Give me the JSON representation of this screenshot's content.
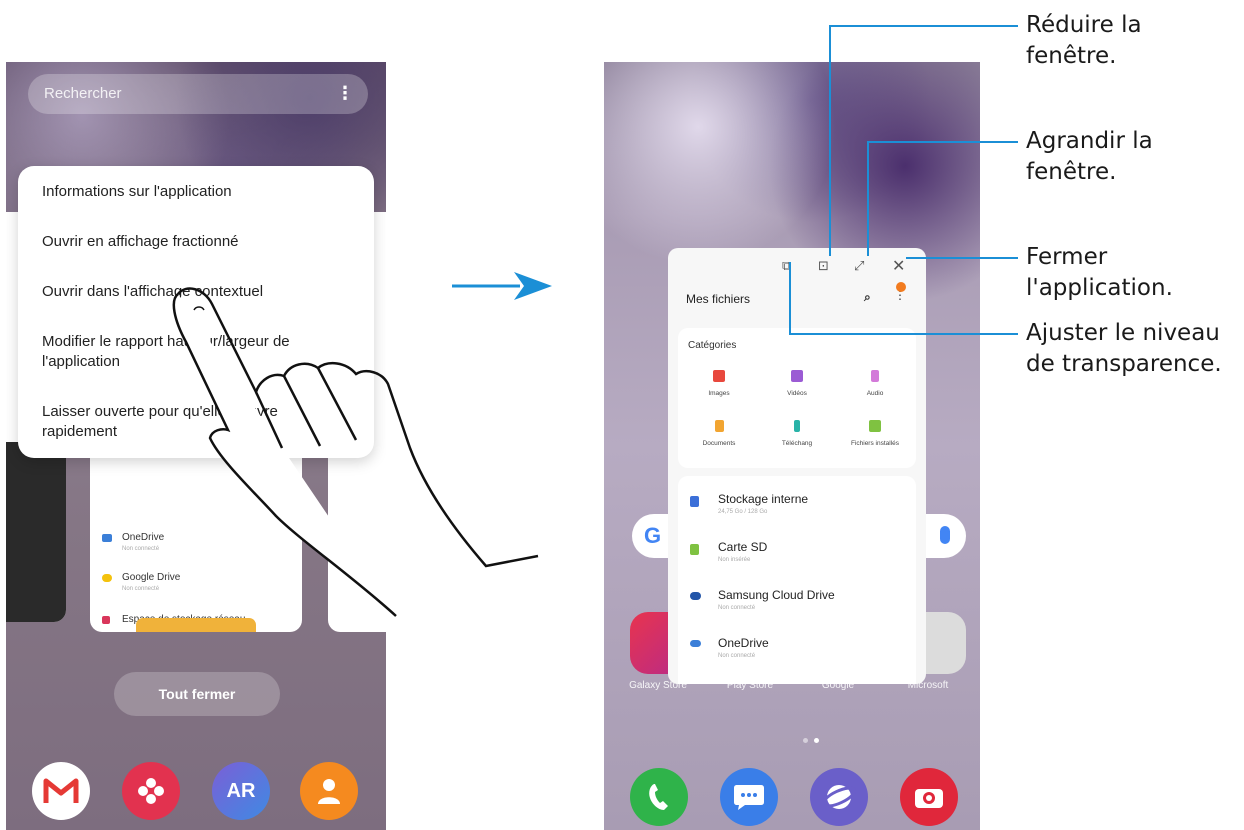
{
  "left_screen": {
    "search_placeholder": "Rechercher",
    "menu_items": [
      "Informations sur l'application",
      "Ouvrir en affichage fractionné",
      "Ouvrir dans l'affichage contextuel",
      "Modifier le rapport hauteur/largeur de l'application",
      "Laisser ouverte pour qu'elle s'ouvre rapidement"
    ],
    "background_list": [
      {
        "name": "OneDrive",
        "sub": "Non connecté"
      },
      {
        "name": "Google Drive",
        "sub": "Non connecté"
      },
      {
        "name": "Espace de stockage réseau",
        "sub": ""
      }
    ],
    "close_all_label": "Tout fermer",
    "dock_apps": [
      "gmail",
      "gallery",
      "AR",
      "contacts"
    ]
  },
  "right_screen": {
    "popup": {
      "title": "Mes fichiers",
      "categories_title": "Catégories",
      "categories": [
        "Images",
        "Vidéos",
        "Audio",
        "Documents",
        "Téléchargements",
        "Fichiers installés"
      ],
      "categories_display": [
        "Images",
        "Vidéos",
        "Audio",
        "Documents",
        "Téléchang",
        "Fichiers installés"
      ],
      "storage": [
        {
          "name": "Stockage interne",
          "sub": "24,75 Go / 128 Go"
        },
        {
          "name": "Carte SD",
          "sub": "Non insérée"
        },
        {
          "name": "Samsung Cloud Drive",
          "sub": "Non connecté"
        },
        {
          "name": "OneDrive",
          "sub": "Non connecté"
        }
      ]
    },
    "home_labels": [
      "Galaxy Store",
      "Play Store",
      "Google",
      "Microsoft"
    ],
    "dock_apps": [
      "phone",
      "messages",
      "internet",
      "camera"
    ]
  },
  "callouts": {
    "minimize": "Réduire la fenêtre.",
    "maximize": "Agrandir la fenêtre.",
    "close": "Fermer l'application.",
    "transparency": "Ajuster le niveau de transparence."
  },
  "colors": {
    "arrow": "#1b8fd6",
    "gmail_red": "#e53935",
    "gallery_red": "#e2324f",
    "ar_blue": "#5a6fd8",
    "contacts_orange": "#f58a1f",
    "phone_green": "#2fb34a",
    "messages_blue": "#3a7ee8",
    "internet_purple": "#6a5fc9",
    "camera_red": "#e0273b"
  }
}
